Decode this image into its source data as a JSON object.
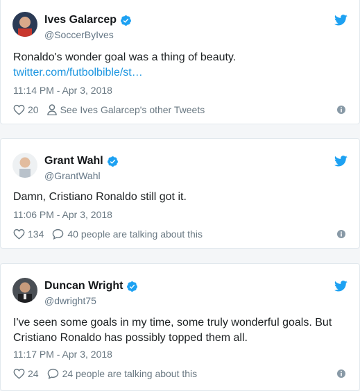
{
  "tweets": [
    {
      "name": "Ives Galarcep",
      "handle": "@SoccerByIves",
      "text": "Ronaldo's wonder goal was a thing of beauty.",
      "link": "twitter.com/futbolbible/st…",
      "time": "11:14 PM - Apr 3, 2018",
      "likes": "20",
      "action_text": "See Ives Galarcep's other Tweets",
      "action_icon": "person-icon"
    },
    {
      "name": "Grant Wahl",
      "handle": "@GrantWahl",
      "text": "Damn, Cristiano Ronaldo still got it.",
      "time": "11:06 PM - Apr 3, 2018",
      "likes": "134",
      "action_text": "40 people are talking about this",
      "action_icon": "reply-bubble-icon"
    },
    {
      "name": "Duncan Wright",
      "handle": "@dwright75",
      "text": "I've seen some goals in my time, some truly wonderful goals. But Cristiano Ronaldo has possibly topped them all.",
      "time": "11:17 PM - Apr 3, 2018",
      "likes": "24",
      "action_text": "24 people are talking about this",
      "action_icon": "reply-bubble-icon"
    }
  ],
  "colors": {
    "twitter_blue": "#1da1f2",
    "link_blue": "#1b95e0",
    "muted_gray": "#697882"
  }
}
